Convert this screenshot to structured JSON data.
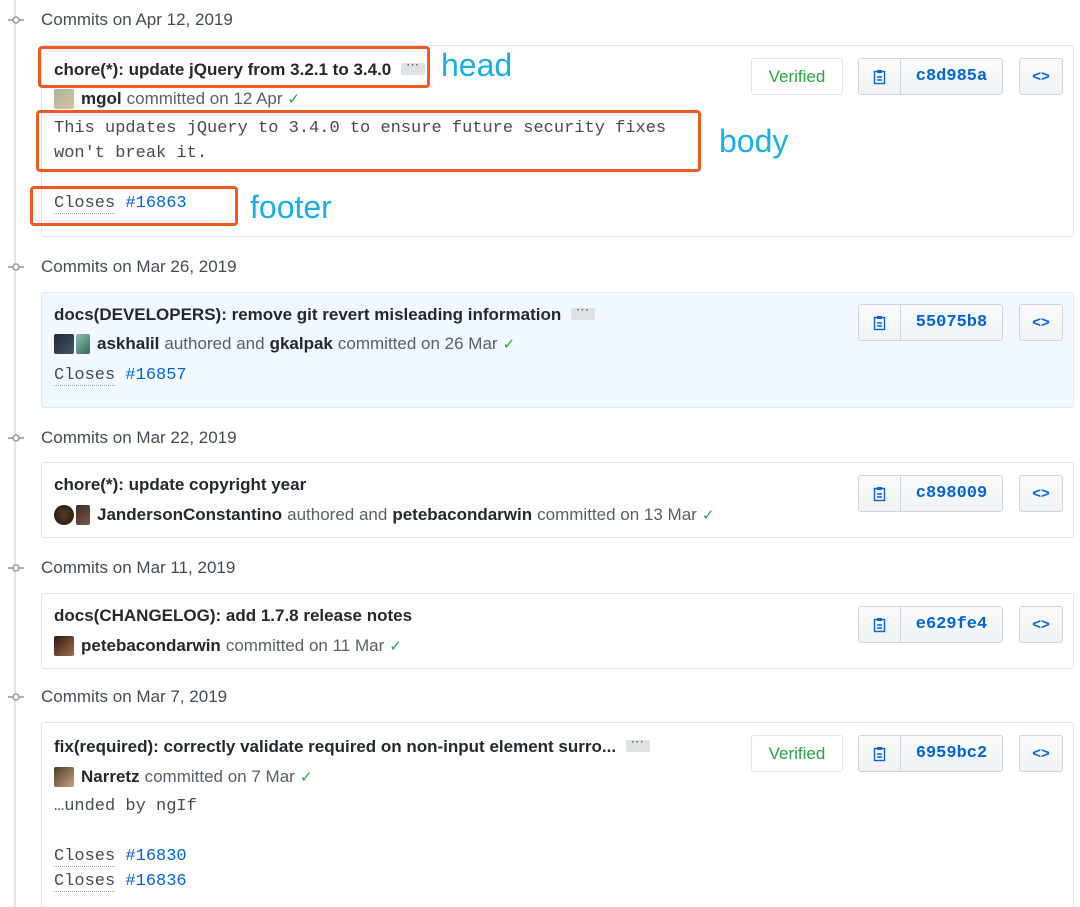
{
  "groups": [
    {
      "date": "Commits on Apr 12, 2019",
      "commit": {
        "title": "chore(*): update jQuery from 3.2.1 to 3.4.0",
        "author": "mgol",
        "action": "committed on 12 Apr",
        "body_line1": "This updates jQuery to 3.4.0 to ensure future security fixes",
        "body_line2": "won't break it.",
        "closes": [
          {
            "word": "Closes",
            "issue": "#16863"
          }
        ],
        "verified": "Verified",
        "sha": "c8d985a"
      }
    },
    {
      "date": "Commits on Mar 26, 2019",
      "commit": {
        "title": "docs(DEVELOPERS): remove git revert misleading information",
        "author": "askhalil",
        "mid": "authored and",
        "committer": "gkalpak",
        "action": "committed on 26 Mar",
        "closes": [
          {
            "word": "Closes",
            "issue": "#16857"
          }
        ],
        "sha": "55075b8"
      }
    },
    {
      "date": "Commits on Mar 22, 2019",
      "commit": {
        "title": "chore(*): update copyright year",
        "author": "JandersonConstantino",
        "mid": "authored and",
        "committer": "petebacondarwin",
        "action": "committed on 13 Mar",
        "sha": "c898009"
      }
    },
    {
      "date": "Commits on Mar 11, 2019",
      "commit": {
        "title": "docs(CHANGELOG): add 1.7.8 release notes",
        "author": "petebacondarwin",
        "action": "committed on 11 Mar",
        "sha": "e629fe4"
      }
    },
    {
      "date": "Commits on Mar 7, 2019",
      "commit": {
        "title": "fix(required): correctly validate required on non-input element surro...",
        "author": "Narretz",
        "action": "committed on 7 Mar",
        "body_line1": "…unded by ngIf",
        "closes": [
          {
            "word": "Closes",
            "issue": "#16830"
          },
          {
            "word": "Closes",
            "issue": "#16836"
          }
        ],
        "verified": "Verified",
        "sha": "6959bc2"
      }
    }
  ],
  "annotations": {
    "head": "head",
    "body": "body",
    "footer": "footer"
  },
  "colors": {
    "annotation_box": "#f05a22",
    "annotation_text": "#1ab0e6",
    "link": "#0366d6",
    "verified": "#28a745"
  },
  "icons": {
    "timeline": "commit-node-icon",
    "copy": "clipboard-icon",
    "browse": "code-brackets-icon",
    "status": "check-icon"
  }
}
